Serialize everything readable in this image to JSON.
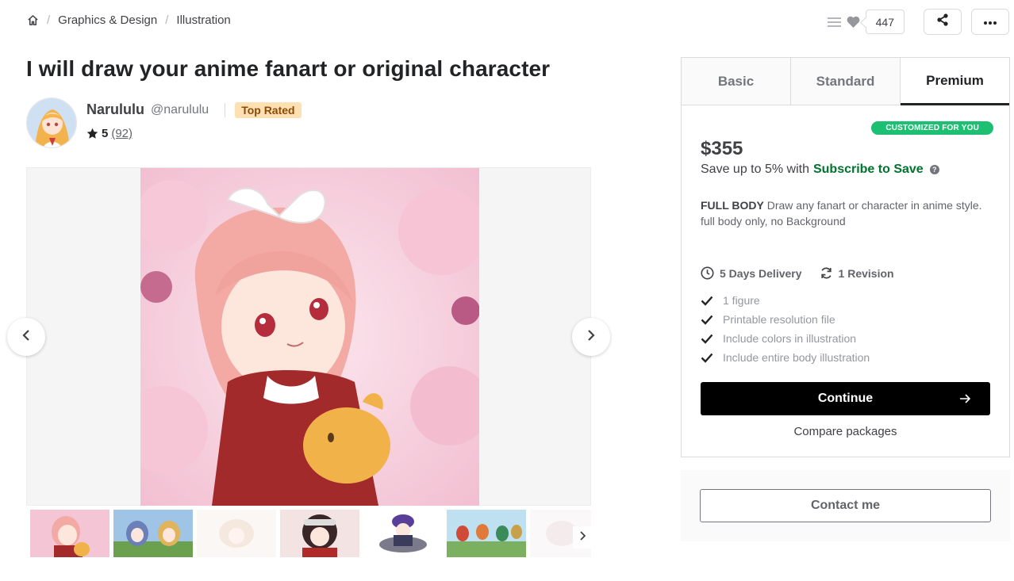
{
  "breadcrumb": {
    "home_icon": "home-icon",
    "items": [
      "Graphics & Design",
      "Illustration"
    ],
    "separator": "/"
  },
  "top_actions": {
    "collections_icon": "list-icon",
    "like_icon": "heart-icon",
    "like_count": "447",
    "share_icon": "share-icon",
    "more_icon": "ellipsis-icon"
  },
  "gig": {
    "title": "I will draw your anime fanart or original character"
  },
  "seller": {
    "name": "Narululu",
    "handle": "@narululu",
    "badge": "Top Rated",
    "rating": "5",
    "reviews": "(92)"
  },
  "gallery": {
    "prev_icon": "chevron-left-icon",
    "next_icon": "chevron-right-icon",
    "thumb_next_icon": "chevron-right-icon",
    "thumbnail_count": 7
  },
  "package": {
    "tabs": [
      "Basic",
      "Standard",
      "Premium"
    ],
    "active_tab": "Premium",
    "customized_badge": "CUSTOMIZED FOR YOU",
    "price": "$355",
    "save_text": "Save up to 5% with",
    "save_link": "Subscribe to Save",
    "help_icon": "question-icon",
    "desc_title": "FULL BODY",
    "desc_text": "Draw any fanart or character in anime style. full body only, no Background",
    "delivery": "5 Days Delivery",
    "revisions": "1 Revision",
    "features": [
      "1 figure",
      "Printable resolution file",
      "Include colors in illustration",
      "Include entire body illustration"
    ],
    "continue_label": "Continue",
    "compare_label": "Compare packages"
  },
  "contact": {
    "label": "Contact me"
  },
  "colors": {
    "accent_green": "#1dbf73",
    "link_green": "#00732e",
    "badge_bg": "#ffe0b3",
    "primary_button": "#000000"
  }
}
